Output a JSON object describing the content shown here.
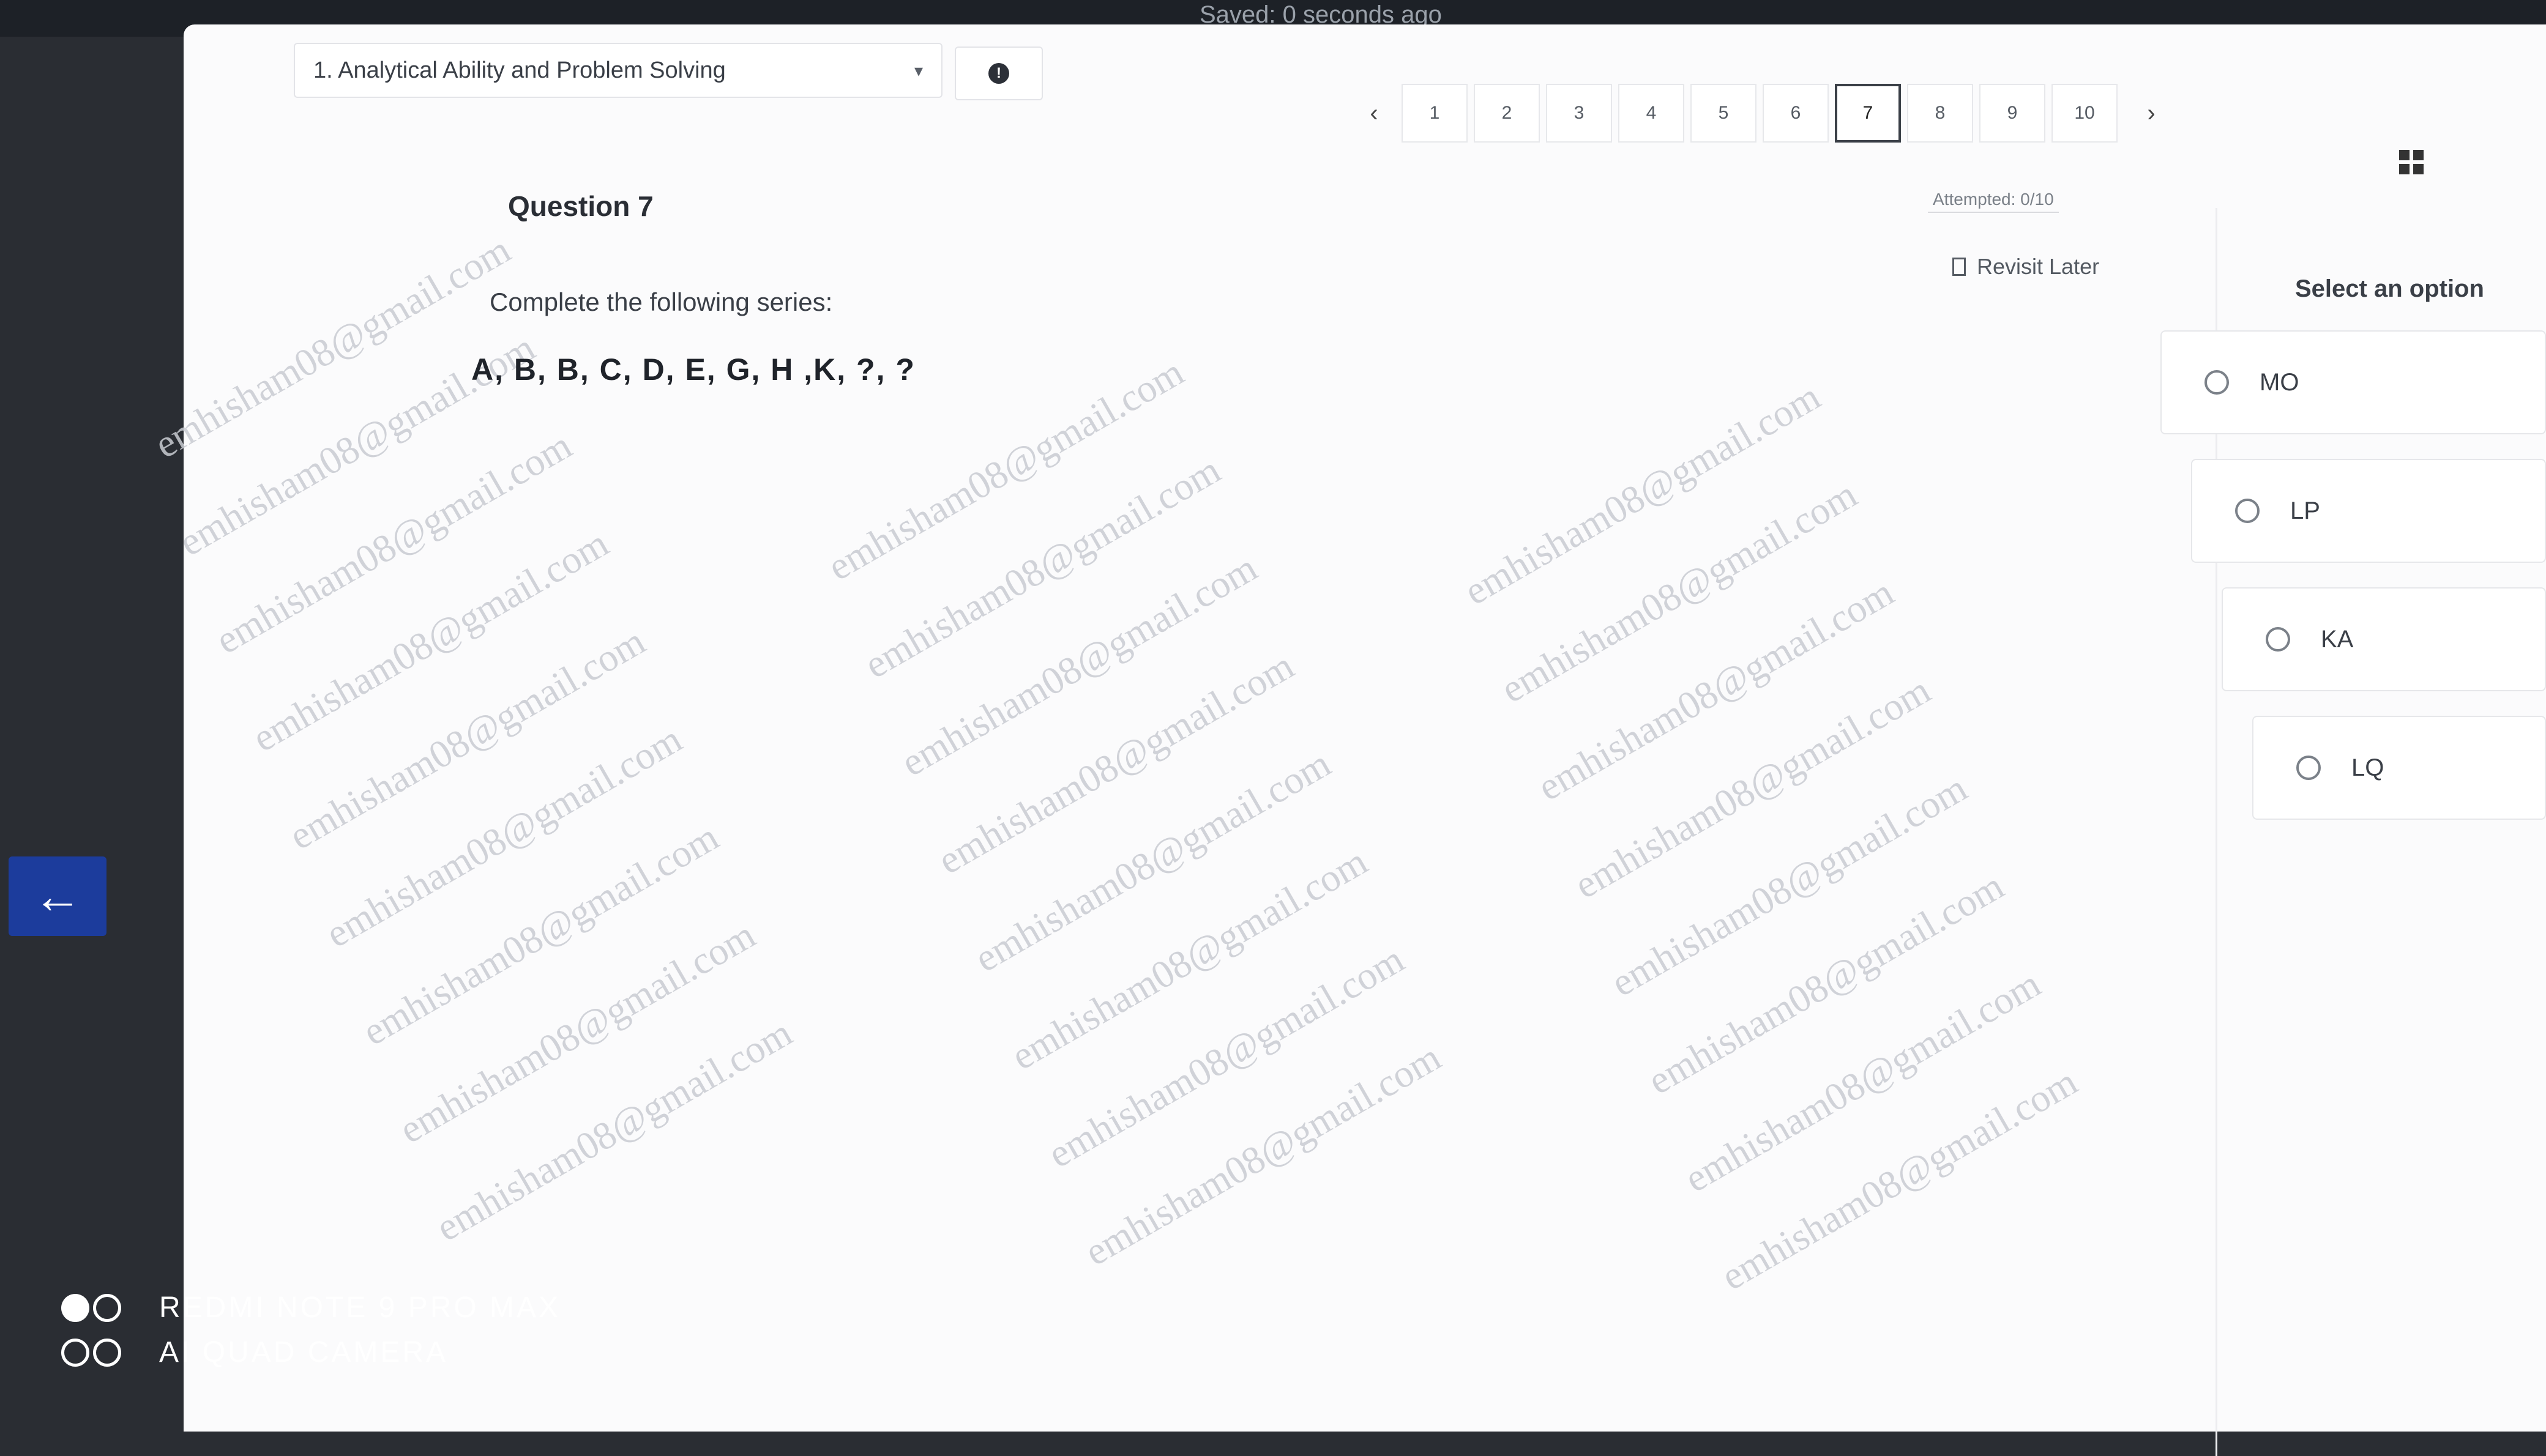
{
  "topbar": {
    "saved_text": "Saved: 0 seconds ago"
  },
  "section": {
    "label": "1. Analytical Ability and Problem Solving"
  },
  "pager": {
    "prev_symbol": "‹",
    "next_symbol": "›",
    "pages": [
      "1",
      "2",
      "3",
      "4",
      "5",
      "6",
      "7",
      "8",
      "9",
      "10"
    ],
    "current_index": 6,
    "attempted_text": "Attempted: 0/10"
  },
  "question": {
    "title": "Question 7",
    "revisit_label": "Revisit Later",
    "prompt": "Complete the following series:",
    "series": "A, B, B, C, D, E, G, H ,K, ?, ?"
  },
  "options_panel": {
    "heading": "Select an option",
    "options": [
      "MO",
      "LP",
      "KA",
      "LQ"
    ]
  },
  "nav": {
    "back_symbol": "←"
  },
  "watermark": {
    "text": "emhisham08@gmail.com"
  },
  "camera": {
    "line1": "REDMI NOTE 9 PRO MAX",
    "line2": "AI QUAD CAMERA"
  },
  "colors": {
    "accent": "#1c3c9c",
    "background": "#fbfbfc",
    "text": "#2a2e35"
  }
}
